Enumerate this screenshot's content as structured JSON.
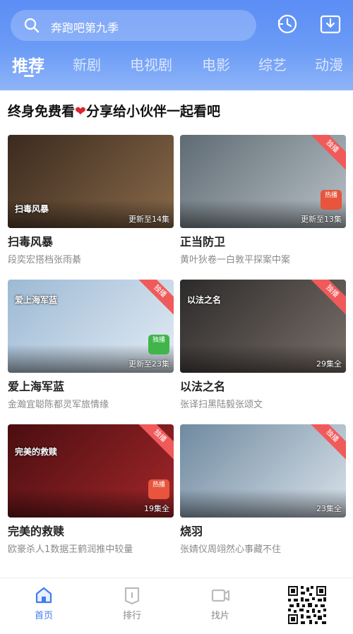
{
  "search": {
    "text": "奔跑吧第九季"
  },
  "header_icons": [
    {
      "name": "history-icon"
    },
    {
      "name": "download-icon"
    }
  ],
  "tabs": [
    {
      "label": "推荐",
      "active": true
    },
    {
      "label": "新剧",
      "active": false
    },
    {
      "label": "电视剧",
      "active": false
    },
    {
      "label": "电影",
      "active": false
    },
    {
      "label": "综艺",
      "active": false
    },
    {
      "label": "动漫",
      "active": false
    }
  ],
  "section": {
    "title_a": "终身免费看",
    "heart": "❤",
    "title_b": "分享给小伙伴一起看吧"
  },
  "cards": [
    {
      "title": "扫毒风暴",
      "subtitle": "段奕宏搭档张雨綦",
      "ep": "更新至14集",
      "art": "扫毒风暴",
      "ribbon": "",
      "badge": "",
      "colors": [
        "#3a2a1e",
        "#8a6a4a"
      ]
    },
    {
      "title": "正当防卫",
      "subtitle": "黄叶狄卷一白敦平探案中案",
      "ep": "更新至13集",
      "art": "",
      "ribbon": "独播",
      "badge": "热播",
      "colors": [
        "#5f6b73",
        "#b8c1c7"
      ]
    },
    {
      "title": "爱上海军蓝",
      "subtitle": "金瀚宜聪陈都灵军旅情缘",
      "ep": "更新至23集",
      "art": "爱上海军蓝",
      "ribbon": "独播",
      "badge": "独播",
      "colors": [
        "#9cb9d4",
        "#e3ecf4"
      ]
    },
    {
      "title": "以法之名",
      "subtitle": "张译扫黑陆毅张颂文",
      "ep": "29集全",
      "art": "以法之名",
      "ribbon": "独播",
      "badge": "",
      "colors": [
        "#2c2a2a",
        "#7a706a"
      ]
    },
    {
      "title": "完美的救赎",
      "subtitle": "欧豪杀人1数据王鹤润推中较量",
      "ep": "19集全",
      "art": "完美的救赎",
      "ribbon": "独播",
      "badge": "热播",
      "colors": [
        "#4a0e10",
        "#a3262a"
      ]
    },
    {
      "title": "烧羽",
      "subtitle": "张婧仪周翊然心事藏不住",
      "ep": "23集全",
      "art": "",
      "ribbon": "独播",
      "badge": "",
      "colors": [
        "#6f8aa0",
        "#d9e2ea"
      ]
    }
  ],
  "bottom_nav": [
    {
      "label": "首页",
      "active": true,
      "icon": "home-icon"
    },
    {
      "label": "排行",
      "active": false,
      "icon": "ranking-icon"
    },
    {
      "label": "找片",
      "active": false,
      "icon": "video-icon"
    }
  ],
  "colors": {
    "accent": "#3f7cf0",
    "header_top": "#5b8df5",
    "ribbon": "#f05a5a",
    "heart": "#d9262c"
  }
}
